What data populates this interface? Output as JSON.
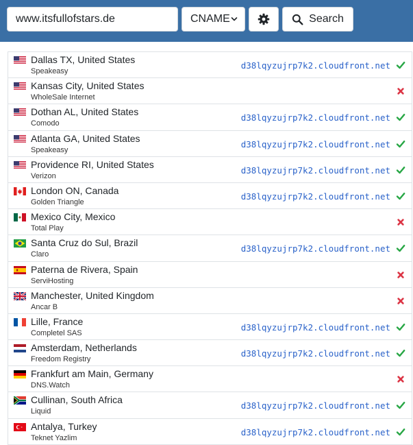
{
  "search": {
    "domain_value": "www.itsfullofstars.de",
    "record_type": "CNAME",
    "search_label": "Search",
    "settings_icon": "gear-icon",
    "search_icon": "magnifier-icon"
  },
  "colors": {
    "header_bg": "#3a6fa5",
    "resolved_text": "#2a62c9",
    "ok": "#28a745",
    "fail": "#dc3545"
  },
  "results": [
    {
      "location": "Dallas TX, United States",
      "provider": "Speakeasy",
      "result": "d38lqyzujrp7k2.cloudfront.net",
      "status": "ok",
      "flag": "us"
    },
    {
      "location": "Kansas City, United States",
      "provider": "WholeSale Internet",
      "result": "",
      "status": "fail",
      "flag": "us"
    },
    {
      "location": "Dothan AL, United States",
      "provider": "Comodo",
      "result": "d38lqyzujrp7k2.cloudfront.net",
      "status": "ok",
      "flag": "us"
    },
    {
      "location": "Atlanta GA, United States",
      "provider": "Speakeasy",
      "result": "d38lqyzujrp7k2.cloudfront.net",
      "status": "ok",
      "flag": "us"
    },
    {
      "location": "Providence RI, United States",
      "provider": "Verizon",
      "result": "d38lqyzujrp7k2.cloudfront.net",
      "status": "ok",
      "flag": "us"
    },
    {
      "location": "London ON, Canada",
      "provider": "Golden Triangle",
      "result": "d38lqyzujrp7k2.cloudfront.net",
      "status": "ok",
      "flag": "ca"
    },
    {
      "location": "Mexico City, Mexico",
      "provider": "Total Play",
      "result": "",
      "status": "fail",
      "flag": "mx"
    },
    {
      "location": "Santa Cruz do Sul, Brazil",
      "provider": "Claro",
      "result": "d38lqyzujrp7k2.cloudfront.net",
      "status": "ok",
      "flag": "br"
    },
    {
      "location": "Paterna de Rivera, Spain",
      "provider": "ServiHosting",
      "result": "",
      "status": "fail",
      "flag": "es"
    },
    {
      "location": "Manchester, United Kingdom",
      "provider": "Ancar B",
      "result": "",
      "status": "fail",
      "flag": "gb"
    },
    {
      "location": "Lille, France",
      "provider": "Completel SAS",
      "result": "d38lqyzujrp7k2.cloudfront.net",
      "status": "ok",
      "flag": "fr"
    },
    {
      "location": "Amsterdam, Netherlands",
      "provider": "Freedom Registry",
      "result": "d38lqyzujrp7k2.cloudfront.net",
      "status": "ok",
      "flag": "nl"
    },
    {
      "location": "Frankfurt am Main, Germany",
      "provider": "DNS.Watch",
      "result": "",
      "status": "fail",
      "flag": "de"
    },
    {
      "location": "Cullinan, South Africa",
      "provider": "Liquid",
      "result": "d38lqyzujrp7k2.cloudfront.net",
      "status": "ok",
      "flag": "za"
    },
    {
      "location": "Antalya, Turkey",
      "provider": "Teknet Yazlim",
      "result": "d38lqyzujrp7k2.cloudfront.net",
      "status": "ok",
      "flag": "tr"
    }
  ]
}
